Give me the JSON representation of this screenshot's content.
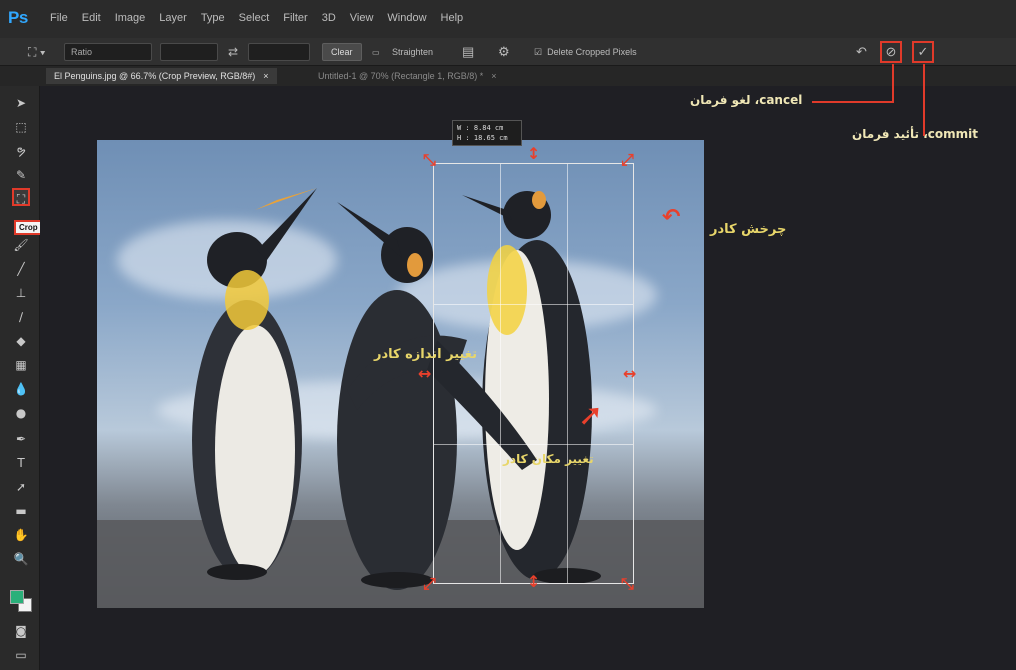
{
  "app": {
    "logo": "Ps"
  },
  "menu": [
    "File",
    "Edit",
    "Image",
    "Layer",
    "Type",
    "Select",
    "Filter",
    "3D",
    "View",
    "Window",
    "Help"
  ],
  "options": {
    "ratio": "Ratio",
    "clear": "Clear",
    "straighten": "Straighten",
    "delete_cropped": "Delete Cropped Pixels"
  },
  "tabs": [
    {
      "label": "El Penguins.jpg @ 66.7% (Crop Preview, RGB/8#)",
      "close": "×"
    },
    {
      "label": "Untitled-1 @ 70% (Rectangle 1, RGB/8) *",
      "close": "×"
    }
  ],
  "tooltip": "Crop Tool (C)",
  "readout": {
    "w": "W :   8.84 cm",
    "h": "H :  18.65 cm"
  },
  "annotations": {
    "cancel": "لغو فرمان ،cancel",
    "commit": "تأئید فرمان ،commit",
    "rotate": "چرخش کادر",
    "resize": "تغییر اندازه کادر",
    "move": "تغییر مکان کادر"
  },
  "colors": {
    "accent_red": "#e03a2a",
    "annotation": "#e8d66a",
    "ps_blue": "#31a8ff"
  }
}
